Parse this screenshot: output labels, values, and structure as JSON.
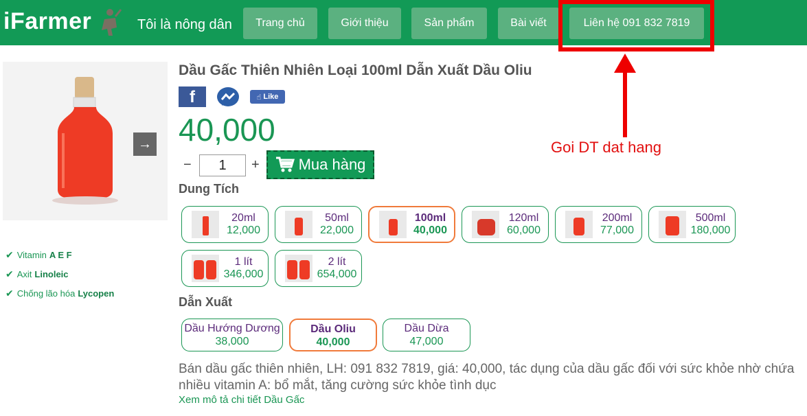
{
  "header": {
    "logo": "iFarmer",
    "tagline": "Tôi là nông dân",
    "nav": [
      {
        "label": "Trang chủ"
      },
      {
        "label": "Giới thiệu"
      },
      {
        "label": "Sản phẩm"
      },
      {
        "label": "Bài viết"
      },
      {
        "label": "Liên hệ 091 832 7819"
      }
    ],
    "annotation": "Goi DT dat hang"
  },
  "product": {
    "title": "Dầu Gấc Thiên Nhiên Loại 100ml Dẫn Xuất Dầu Oliu",
    "price": "40,000",
    "quantity": "1",
    "buy_label": "Mua hàng",
    "like_label": "Like",
    "fb_label": "f"
  },
  "features": [
    {
      "prefix": "Vitamin",
      "strong": "A E F"
    },
    {
      "prefix": "Axit",
      "strong": "Linoleic"
    },
    {
      "prefix": "Chống lão hóa",
      "strong": "Lycopen"
    }
  ],
  "volume": {
    "label": "Dung Tích",
    "options": [
      {
        "name": "20ml",
        "price": "12,000"
      },
      {
        "name": "50ml",
        "price": "22,000"
      },
      {
        "name": "100ml",
        "price": "40,000",
        "selected": true
      },
      {
        "name": "120ml",
        "price": "60,000"
      },
      {
        "name": "200ml",
        "price": "77,000"
      },
      {
        "name": "500ml",
        "price": "180,000"
      },
      {
        "name": "1 lít",
        "price": "346,000"
      },
      {
        "name": "2 lít",
        "price": "654,000"
      }
    ]
  },
  "derivative": {
    "label": "Dẫn Xuất",
    "options": [
      {
        "name": "Dầu Hướng Dương",
        "price": "38,000"
      },
      {
        "name": "Dầu Oliu",
        "price": "40,000",
        "selected": true
      },
      {
        "name": "Dầu Dừa",
        "price": "47,000"
      }
    ]
  },
  "description": "Bán dầu gấc thiên nhiên, LH: 091 832 7819, giá: 40,000, tác dụng của dầu gấc đối với sức khỏe nhờ chứa nhiều vitamin A: bổ mắt, tăng cường sức khỏe tình dục",
  "more_link": "Xem mô tả chi tiết Dầu Gấc",
  "colors": {
    "brand_green": "#129a56",
    "nav_button": "#5bb180",
    "selected_border": "#f07a3a",
    "annotation_red": "#ee0000"
  }
}
